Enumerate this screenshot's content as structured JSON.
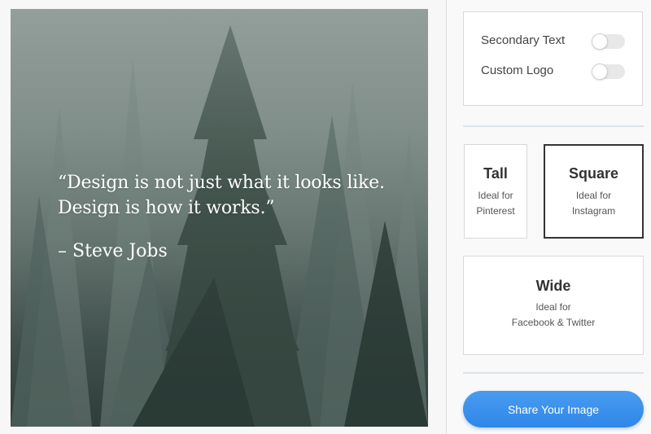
{
  "preview": {
    "quote": "“Design is not just what it looks like.\nDesign is how it works.”",
    "author": "– Steve Jobs"
  },
  "options": {
    "secondary_text": {
      "label": "Secondary Text",
      "enabled": false
    },
    "custom_logo": {
      "label": "Custom Logo",
      "enabled": false
    }
  },
  "sizes": [
    {
      "title": "Tall",
      "subtitle": "Ideal for\nPinterest",
      "selected": false
    },
    {
      "title": "Square",
      "subtitle": "Ideal for\nInstagram",
      "selected": true
    },
    {
      "title": "Wide",
      "subtitle": "Ideal for\nFacebook & Twitter",
      "selected": false
    }
  ],
  "share_button": {
    "label": "Share Your Image",
    "color": "#3b8fec"
  },
  "colors": {
    "selected_border": "#333333",
    "card_border": "#d9d9d9",
    "divider": "#dde3ea"
  }
}
